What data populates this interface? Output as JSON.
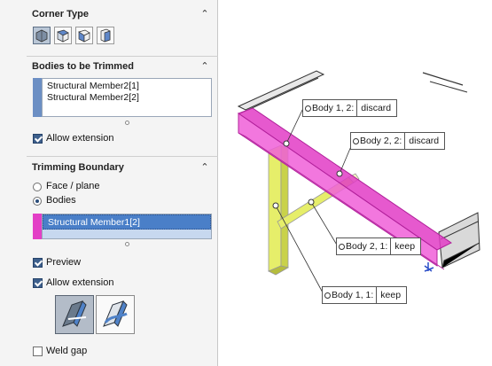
{
  "panel": {
    "corner_type": {
      "title": "Corner Type",
      "buttons": [
        "end-trim-icon",
        "end-miter-icon",
        "end-butt1-icon",
        "end-butt2-icon"
      ]
    },
    "bodies_to_trim": {
      "title": "Bodies to be Trimmed",
      "items": [
        "Structural Member2[1]",
        "Structural Member2[2]"
      ],
      "allow_extension_label": "Allow extension"
    },
    "trimming_boundary": {
      "title": "Trimming Boundary",
      "face_plane_label": "Face / plane",
      "bodies_label": "Bodies",
      "selected_item": "Structural Member1[2]",
      "preview_label": "Preview",
      "allow_extension_label": "Allow extension",
      "weld_gap_label": "Weld gap"
    }
  },
  "callouts": [
    {
      "name": "Body 1,  2:",
      "state": "discard"
    },
    {
      "name": "Body 2,  2:",
      "state": "discard"
    },
    {
      "name": "Body 2,  1:",
      "state": "keep"
    },
    {
      "name": "Body 1,  1:",
      "state": "keep"
    }
  ],
  "colors": {
    "accent": "#3d6fb6",
    "highlight_pink": "#e23cc6",
    "member_yellow": "#e6ee6a",
    "selection_blue": "#4a7fc8"
  }
}
